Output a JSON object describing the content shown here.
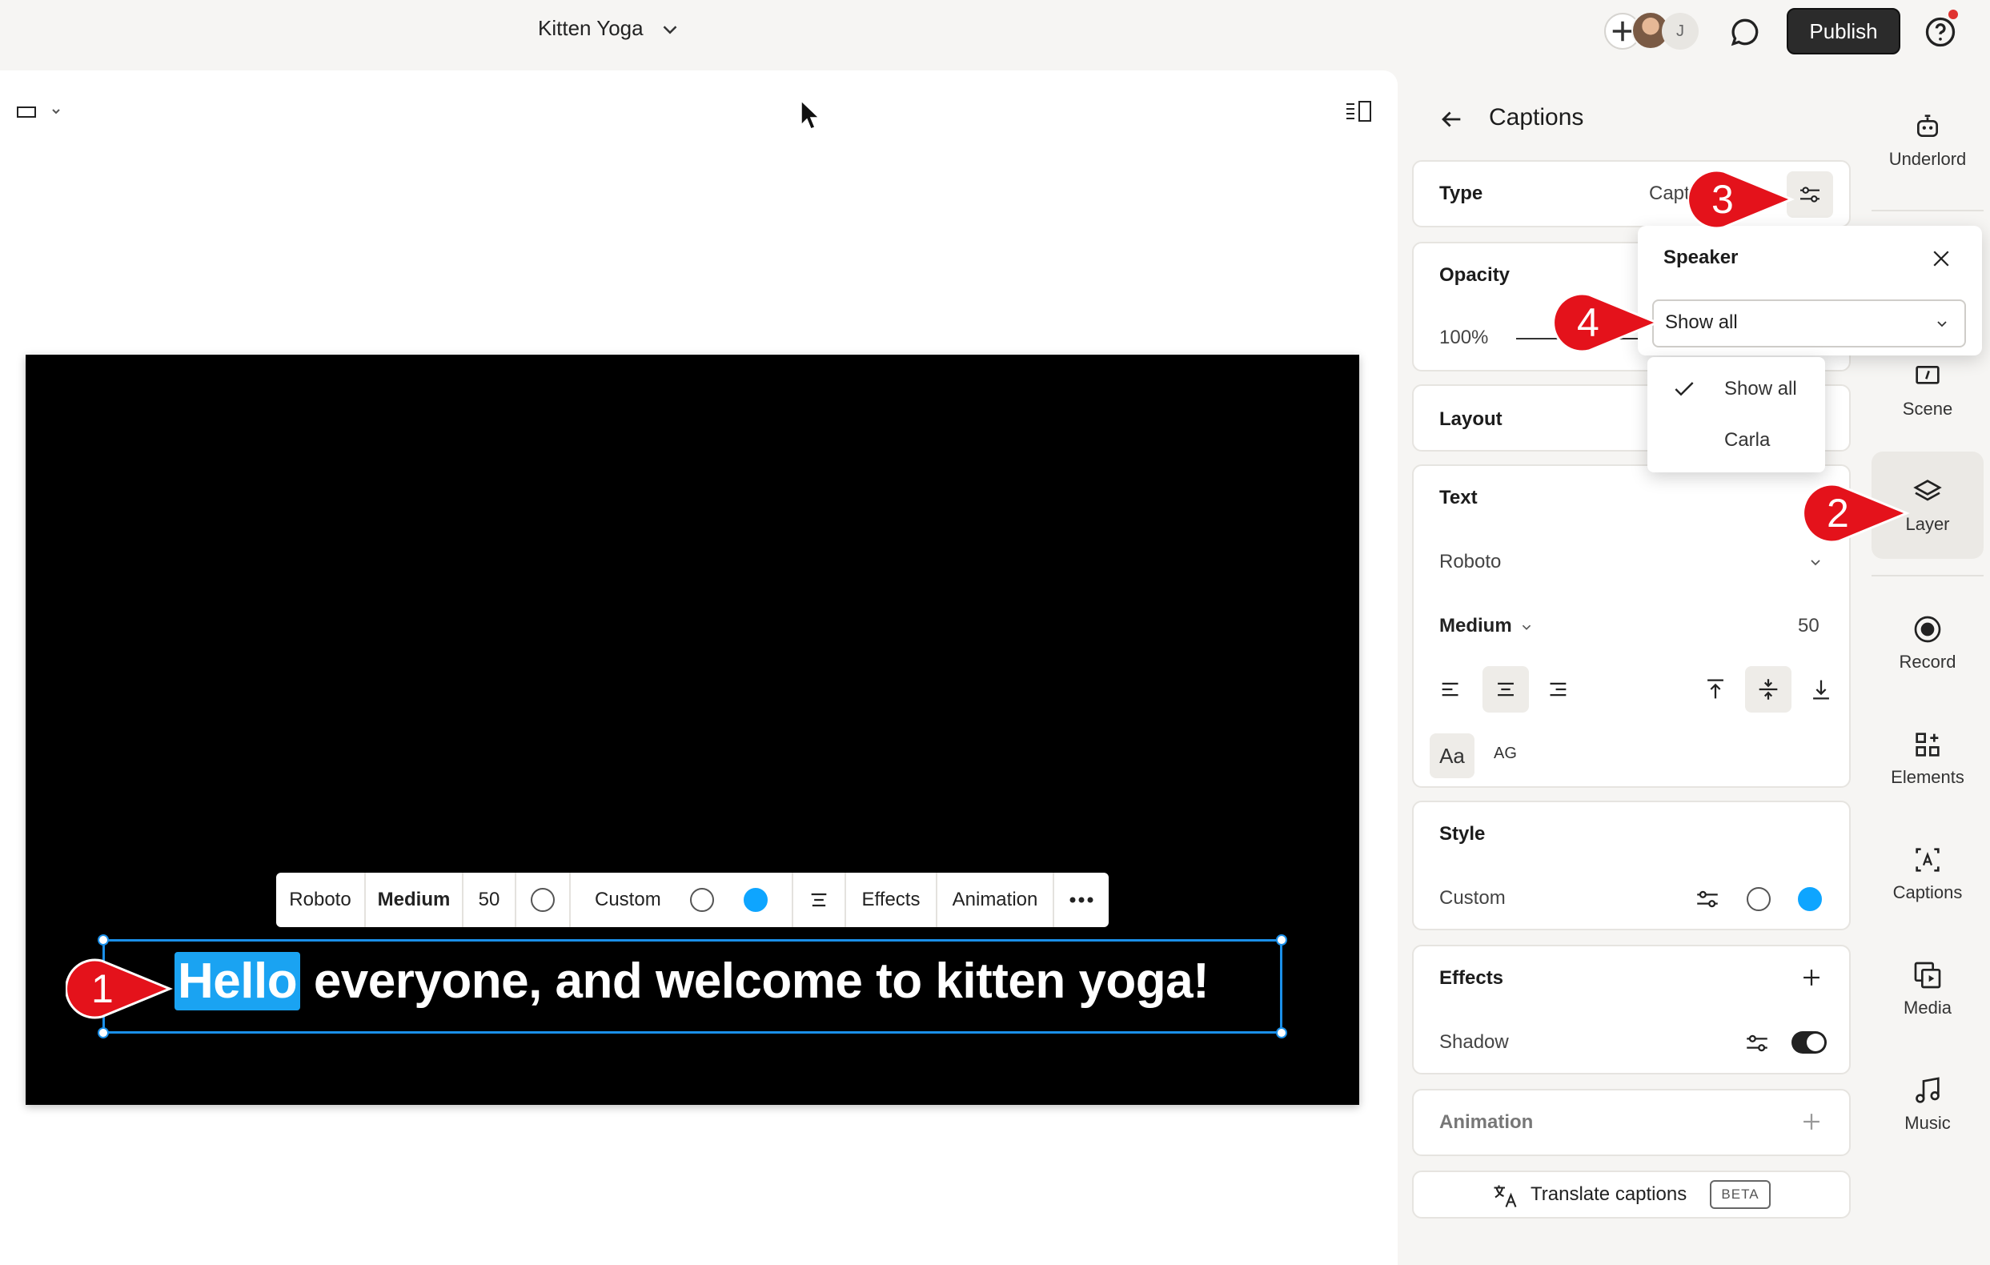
{
  "header": {
    "project_title": "Kitten Yoga",
    "collaborator_initial": "J",
    "publish_label": "Publish"
  },
  "toolbar": {
    "font": "Roboto",
    "weight": "Medium",
    "size": "50",
    "style": "Custom",
    "effects": "Effects",
    "animation": "Animation"
  },
  "caption": {
    "highlight_word": "Hello",
    "rest": " everyone, and welcome to kitten yoga!"
  },
  "panel": {
    "title": "Captions",
    "type_label": "Type",
    "type_value": "Capt",
    "opacity_label": "Opacity",
    "opacity_value": "100%",
    "layout_label": "Layout",
    "text_label": "Text",
    "font": "Roboto",
    "weight": "Medium",
    "size": "50",
    "case_mixed": "Aa",
    "case_upper": "AG",
    "style_label": "Style",
    "style_value": "Custom",
    "effects_label": "Effects",
    "shadow_label": "Shadow",
    "animation_label": "Animation",
    "translate_label": "Translate captions",
    "beta_badge": "BETA"
  },
  "speaker_popover": {
    "title": "Speaker",
    "selected": "Show all",
    "options": [
      "Show all",
      "Carla"
    ]
  },
  "rail": {
    "items": [
      "Underlord",
      "Scene",
      "Layer",
      "Record",
      "Elements",
      "Captions",
      "Media",
      "Music"
    ]
  },
  "callouts": [
    "1",
    "2",
    "3",
    "4"
  ],
  "colors": {
    "accent_blue": "#0ea5ff",
    "callout_red": "#e4121b",
    "publish_bg": "#2b2b2b"
  }
}
